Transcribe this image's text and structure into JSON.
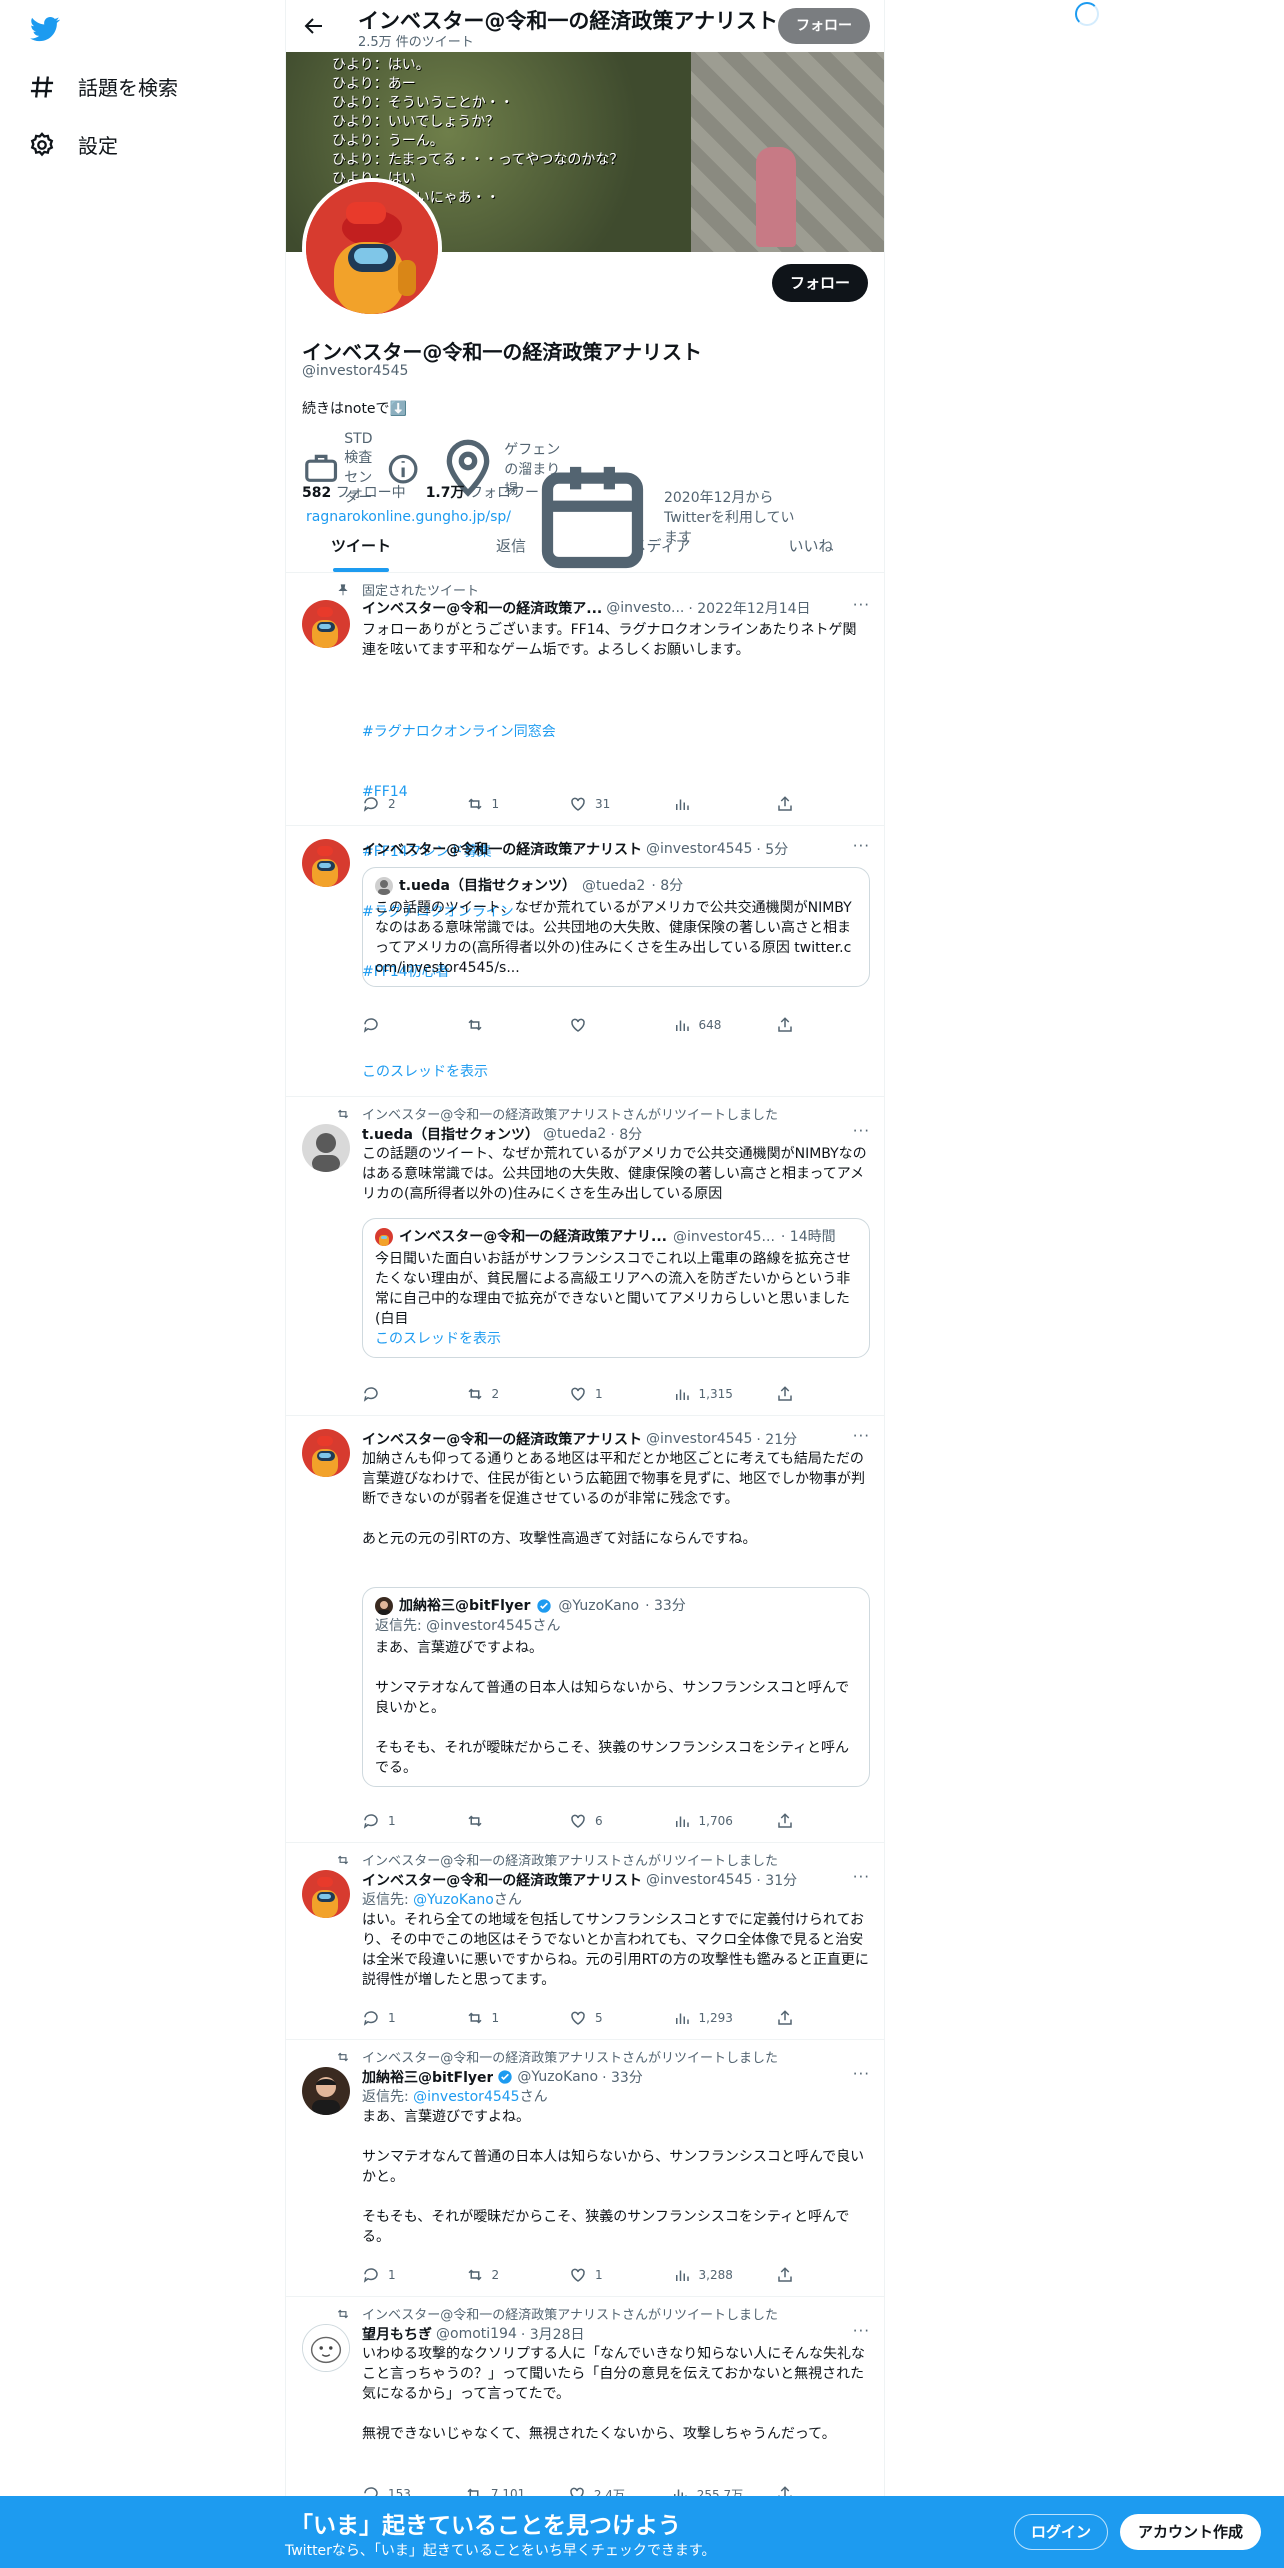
{
  "nav": {
    "items": [
      {
        "label": "話題を検索",
        "icon": "hashtag-icon"
      },
      {
        "label": "設定",
        "icon": "gear-icon"
      }
    ]
  },
  "header": {
    "name": "インベスター@令和一の経済政策アナリスト",
    "tweet_count": "2.5万 件のツイート",
    "follow_label": "フォロー"
  },
  "banner": {
    "dialog_lines": [
      "ひより：はい。",
      "ひより：あー",
      "ひより：そういうことか・・",
      "ひより：いいでしょうか？",
      "ひより：うーん。",
      "ひより：たまってる・・・ってやつなのかな？",
      "ひより：はい",
      "ひより：かないにゃあ・・"
    ]
  },
  "profile": {
    "follow_label": "フォロー",
    "name": "インベスター@令和一の経済政策アナリスト",
    "handle": "@investor4545",
    "bio": "続きはnoteで⬇️",
    "location_a": "STD検査センター",
    "location_b": "ゲフェンの溜まり場",
    "link": "ragnarokonline.gungho.jp/sp/",
    "joined": "2020年12月からTwitterを利用しています",
    "following_count": "582",
    "following_label": "フォロー中",
    "followers_count": "1.7万",
    "followers_label": "フォロワー"
  },
  "tabs": [
    "ツイート",
    "返信",
    "メディア",
    "いいね"
  ],
  "tweets": [
    {
      "context": "固定されたツイート",
      "name": "インベスター@令和一の経済政策ア...",
      "handle": "@investo...",
      "time": "· 2022年12月14日",
      "body": "フォローありがとうございます。FF14、ラグナロクオンラインあたりネトゲ関連を呟いてます平和なゲーム垢です。よろしくお願いします。",
      "tags": [
        "#ラグナロクオンライン同窓会",
        "#FF14",
        "#FF14フレンド募集",
        "#ラグナロクオンライン",
        "#FF14初心者"
      ],
      "reply": "2",
      "retweet": "1",
      "like": "31",
      "views": ""
    },
    {
      "name": "インベスター@令和一の経済政策アナリスト",
      "handle": "@investor4545",
      "time": "· 5分",
      "quote": {
        "name": "t.ueda（目指せクォンツ）",
        "handle": "@tueda2",
        "time": "· 8分",
        "body": "この話題のツイート、なぜか荒れているがアメリカで公共交通機関がNIMBYなのはある意味常識では。公共団地の大失敗、健康保険の著しい高さと相まってアメリカの(高所得者以外の)住みにくさを生み出している原因 twitter.com/investor4545/s..."
      },
      "reply": "",
      "retweet": "",
      "like": "",
      "views": "648",
      "show_thread": "このスレッドを表示"
    },
    {
      "context": "インベスター@令和一の経済政策アナリストさんがリツイートしました",
      "name": "t.ueda（目指せクォンツ）",
      "handle": "@tueda2",
      "time": "· 8分",
      "body": "この話題のツイート、なぜか荒れているがアメリカで公共交通機関がNIMBYなのはある意味常識では。公共団地の大失敗、健康保険の著しい高さと相まってアメリカの(高所得者以外の)住みにくさを生み出している原因",
      "quote": {
        "name": "インベスター@令和一の経済政策アナリ...",
        "handle": "@investor45...",
        "time": "· 14時間",
        "body": "今日聞いた面白いお話がサンフランシスコでこれ以上電車の路線を拡充させたくない理由が、貧民層による高級エリアへの流入を防ぎたいからという非常に自己中的な理由で拡充ができないと聞いてアメリカらしいと思いました(白目",
        "show_thread": "このスレッドを表示"
      },
      "reply": "",
      "retweet": "2",
      "like": "1",
      "views": "1,315"
    },
    {
      "name": "インベスター@令和一の経済政策アナリスト",
      "handle": "@investor4545",
      "time": "· 21分",
      "body": "加納さんも仰ってる通りとある地区は平和だとか地区ごとに考えても結局ただの言葉遊びなわけで、住民が街という広範囲で物事を見ずに、地区でしか物事が判断できないのが弱者を促進させているのが非常に残念です。\n\nあと元の元の引RTの方、攻撃性高過ぎて対話にならんですね。",
      "quote": {
        "name": "加納裕三@bitFlyer",
        "handle": "@YuzoKano",
        "time": "· 33分",
        "reply_to": "返信先: @investor4545さん",
        "body": "まあ、言葉遊びですよね。\n\nサンマテオなんて普通の日本人は知らないから、サンフランシスコと呼んで良いかと。\n\nそもそも、それが曖昧だからこそ、狭義のサンフランシスコをシティと呼んでる。"
      },
      "reply": "1",
      "retweet": "",
      "like": "6",
      "views": "1,706"
    },
    {
      "context": "インベスター@令和一の経済政策アナリストさんがリツイートしました",
      "name": "インベスター@令和一の経済政策アナリスト",
      "handle": "@investor4545",
      "time": "· 31分",
      "reply_prefix": "返信先:",
      "reply_handle": "@YuzoKano",
      "reply_suffix": "さん",
      "body": "はい。それら全ての地域を包括してサンフランシスコとすでに定義付けられており、その中でこの地区はそうでないとか言われても、マクロ全体像で見ると治安は全米で段違いに悪いですからね。元の引用RTの方の攻撃性も鑑みると正直更に説得性が増したと思ってます。",
      "reply": "1",
      "retweet": "1",
      "like": "5",
      "views": "1,293"
    },
    {
      "context": "インベスター@令和一の経済政策アナリストさんがリツイートしました",
      "name": "加納裕三@bitFlyer",
      "handle": "@YuzoKano",
      "time": "· 33分",
      "reply_prefix": "返信先:",
      "reply_handle": "@investor4545",
      "reply_suffix": "さん",
      "body": "まあ、言葉遊びですよね。\n\nサンマテオなんて普通の日本人は知らないから、サンフランシスコと呼んで良いかと。\n\nそもそも、それが曖昧だからこそ、狭義のサンフランシスコをシティと呼んでる。",
      "reply": "1",
      "retweet": "2",
      "like": "1",
      "views": "3,288"
    },
    {
      "context": "インベスター@令和一の経済政策アナリストさんがリツイートしました",
      "name": "望月もちぎ",
      "handle": "@omoti194",
      "time": "· 3月28日",
      "body": "いわゆる攻撃的なクソリプする人に「なんでいきなり知らない人にそんな失礼なこと言っちゃうの？」って聞いたら「自分の意見を伝えておかないと無視された気になるから」って言ってたで。\n\n無視できないじゃなくて、無視されたくないから、攻撃しちゃうんだって。",
      "reply": "153",
      "retweet": "7,101",
      "like": "2.4万",
      "views": "255.7万"
    }
  ],
  "bottom_bar": {
    "title": "「いま」起きていることを見つけよう",
    "subtitle": "Twitterなら、「いま」起きていることをいち早くチェックできます。",
    "login": "ログイン",
    "signup": "アカウント作成"
  },
  "colors": {
    "accent": "#1d9bf0",
    "text": "#0f1419",
    "muted": "#536471"
  }
}
